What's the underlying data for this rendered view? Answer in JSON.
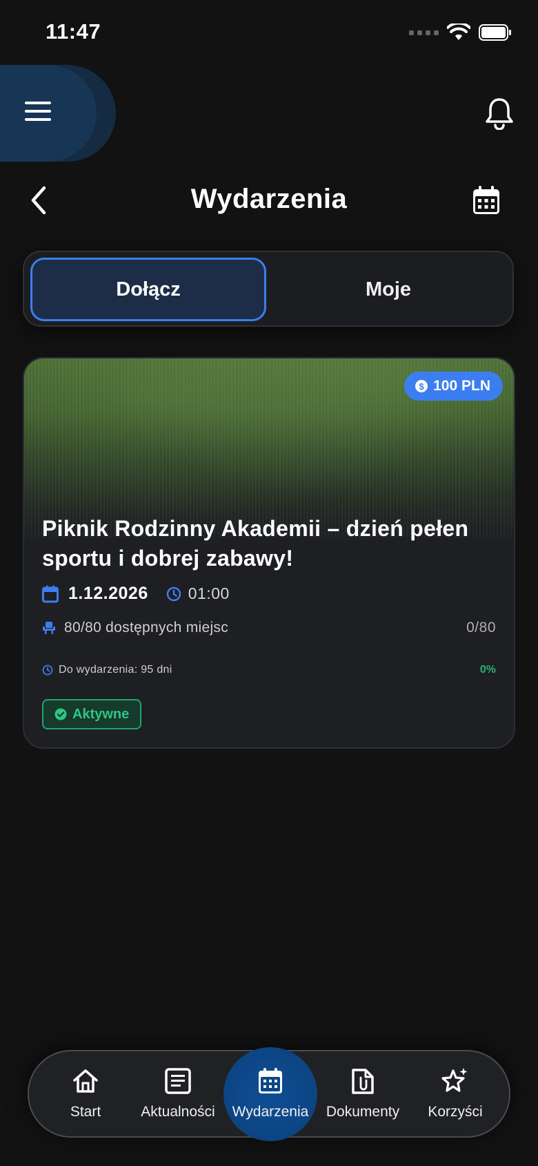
{
  "status_bar": {
    "time": "11:47"
  },
  "header": {
    "title": "Wydarzenia"
  },
  "tabs": [
    {
      "label": "Dołącz",
      "active": true
    },
    {
      "label": "Moje",
      "active": false
    }
  ],
  "event": {
    "price": "100 PLN",
    "title": "Piknik Rodzinny Akademii – dzień pełen sportu i dobrej zabawy!",
    "date": "1.12.2026",
    "time": "01:00",
    "seats_text": "80/80 dostępnych miejsc",
    "seats_count": "0/80",
    "countdown": "Do wydarzenia: 95 dni",
    "progress_percent": "0%",
    "status": "Aktywne"
  },
  "bottom_nav": [
    {
      "label": "Start",
      "icon": "home-icon"
    },
    {
      "label": "Aktualności",
      "icon": "news-icon"
    },
    {
      "label": "Wydarzenia",
      "icon": "calendar-icon",
      "active": true
    },
    {
      "label": "Dokumenty",
      "icon": "document-icon"
    },
    {
      "label": "Korzyści",
      "icon": "stars-icon"
    }
  ],
  "colors": {
    "background": "#121213",
    "accent": "#3c7ef0",
    "success": "#2ec584",
    "nav_active": "#0d4686"
  }
}
